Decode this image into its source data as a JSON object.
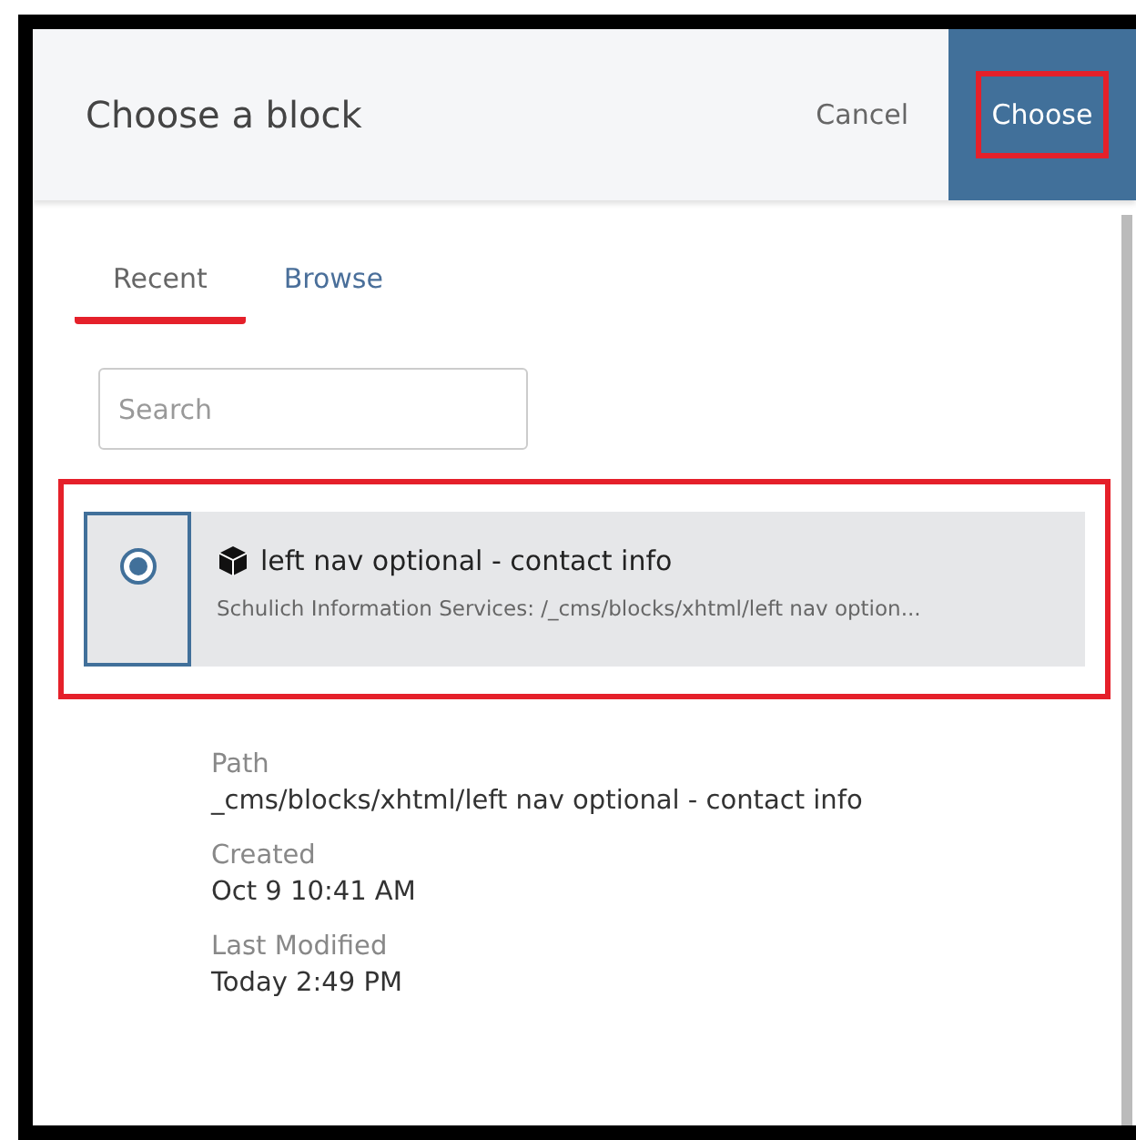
{
  "dialog": {
    "title": "Choose a block"
  },
  "actions": [
    {
      "kind": "link",
      "label": "Cancel"
    },
    {
      "kind": "primary",
      "label": "Choose",
      "highlighted": true
    }
  ],
  "tabs": [
    {
      "label": "Recent",
      "selected": true
    },
    {
      "label": "Browse",
      "selected": false
    }
  ],
  "search": {
    "placeholder": "Search"
  },
  "results": [
    {
      "title": "left nav optional - contact info",
      "subtitle": "Schulich Information Services: /_cms/blocks/xhtml/left nav option...",
      "selected": true,
      "highlighted": true
    }
  ],
  "details": [
    {
      "label": "Path",
      "value": "_cms/blocks/xhtml/left nav optional - contact info"
    },
    {
      "label": "Created",
      "value": "Oct 9 10:41 AM"
    },
    {
      "label": "Last Modified",
      "value": "Today 2:49 PM"
    }
  ]
}
